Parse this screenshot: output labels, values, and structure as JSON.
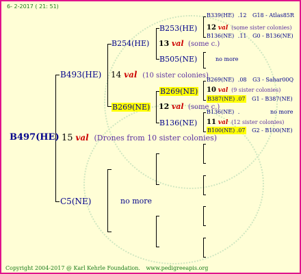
{
  "header": {
    "date": "6- 2-2017 ( 21: 51)"
  },
  "root": {
    "id": "B497(HE)",
    "count": "15",
    "val": "val",
    "note": "(Drones from 10 sister colonies)"
  },
  "sire": {
    "id": "B493(HE)",
    "count": "14",
    "val": "val",
    "note": "(10 sister colonies)",
    "b254": {
      "id": "B254(HE)",
      "count": "13",
      "val": "val",
      "note": "(some c.)",
      "b253": {
        "id": "B253(HE)",
        "count": "12",
        "val": "val",
        "note": "(some sister colonies)",
        "top": {
          "id": "B339(HE)",
          "num": ".12",
          "group": "G18 - Atlas85R"
        },
        "bottom": {
          "id": "B136(NE)",
          "num": ".11",
          "group": "G0 - B136(NE)"
        }
      },
      "b505": {
        "id": "B505(NE)",
        "more": "no more"
      }
    },
    "b269": {
      "id": "B269(NE)",
      "count": "12",
      "val": "val",
      "note": "(some c.)",
      "b269b": {
        "id": "B269(NE)",
        "count": "10",
        "val": "val",
        "note": "(9 sister colonies)",
        "top": {
          "id": "B269(NE)",
          "num": ".08",
          "group": "G3 - Sahar00Q"
        },
        "bottom": {
          "id": "B387(NE)",
          "num": ".07",
          "group": "G1 - B387(NE)"
        }
      },
      "b136": {
        "id": "B136(NE)",
        "count": "11",
        "val": "val",
        "note": "(12 sister colonies)",
        "top": {
          "id": "B136(NE)",
          "num": ".",
          "more": "no more"
        },
        "bottom": {
          "id": "B100(NE)",
          "num": ".07",
          "group": "G2 - B100(NE)"
        }
      }
    }
  },
  "dam": {
    "id": "C5(NE)",
    "more": "no more"
  },
  "footer": {
    "copyright": "Copyright 2004-2017 @ Karl Kehrle Foundation.",
    "site": "www.pedigreeapis.org"
  }
}
